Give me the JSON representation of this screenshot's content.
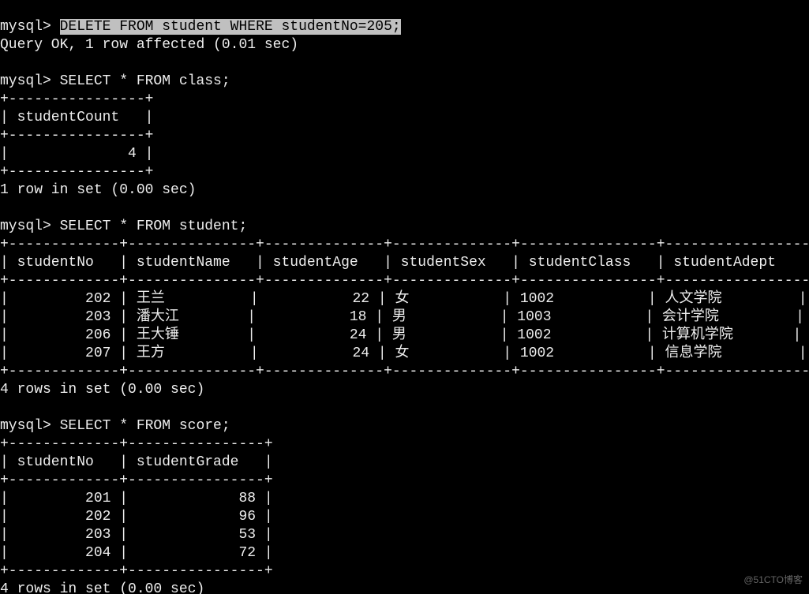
{
  "watermark": "@51CTO博客",
  "prompt": "mysql>",
  "commands": {
    "delete": "DELETE FROM student WHERE studentNo=205;",
    "delete_result": "Query OK, 1 row affected (0.01 sec)",
    "select_class": "SELECT * FROM class;",
    "select_student": "SELECT * FROM student;",
    "select_score": "SELECT * FROM score;",
    "class_footer": "1 row in set (0.00 sec)",
    "student_footer": "4 rows in set (0.00 sec)",
    "score_footer": "4 rows in set (0.00 sec)"
  },
  "chart_data": [
    {
      "type": "table",
      "title": "class",
      "columns": [
        "studentCount"
      ],
      "widths": [
        14
      ],
      "align": [
        "r"
      ],
      "rows": [
        [
          4
        ]
      ]
    },
    {
      "type": "table",
      "title": "student",
      "columns": [
        "studentNo",
        "studentName",
        "studentAge",
        "studentSex",
        "studentClass",
        "studentAdept"
      ],
      "widths": [
        11,
        13,
        12,
        12,
        14,
        16
      ],
      "align": [
        "r",
        "l",
        "r",
        "l",
        "l",
        "l"
      ],
      "rows": [
        [
          202,
          "王兰",
          22,
          "女",
          "1002",
          "人文学院"
        ],
        [
          203,
          "潘大江",
          18,
          "男",
          "1003",
          "会计学院"
        ],
        [
          206,
          "王大锤",
          24,
          "男",
          "1002",
          "计算机学院"
        ],
        [
          207,
          "王方",
          24,
          "女",
          "1002",
          "信息学院"
        ]
      ]
    },
    {
      "type": "table",
      "title": "score",
      "columns": [
        "studentNo",
        "studentGrade"
      ],
      "widths": [
        11,
        14
      ],
      "align": [
        "r",
        "r"
      ],
      "rows": [
        [
          201,
          88
        ],
        [
          202,
          96
        ],
        [
          203,
          53
        ],
        [
          204,
          72
        ]
      ]
    }
  ]
}
